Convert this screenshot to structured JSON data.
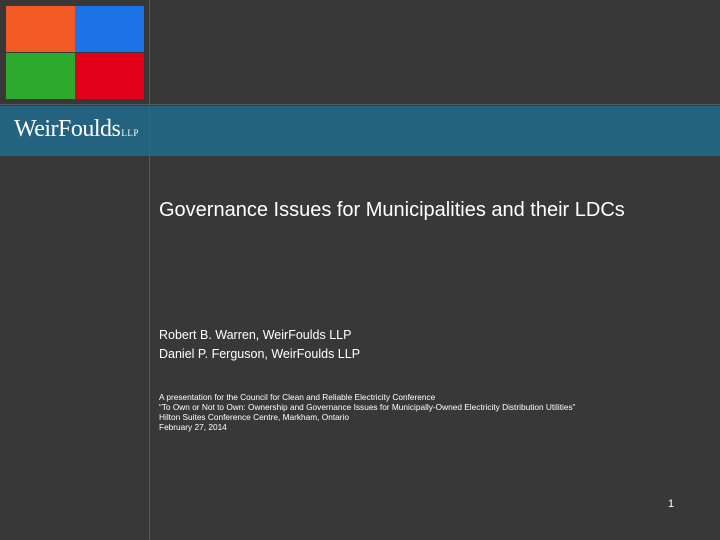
{
  "logo": {
    "name": "WeirFoulds",
    "suffix": "LLP"
  },
  "title": "Governance Issues for Municipalities and their LDCs",
  "authors": [
    "Robert B. Warren, WeirFoulds LLP",
    "Daniel P. Ferguson, WeirFoulds LLP"
  ],
  "conference": [
    "A presentation for the Council for Clean and Reliable Electricity Conference",
    "“To Own or Not to Own: Ownership and Governance Issues for Municipally-Owned Electricity Distribution Utilities”",
    "Hilton Suites Conference Centre, Markham, Ontario",
    "February 27, 2014"
  ],
  "page_number": "1",
  "colors": {
    "background": "#383838",
    "band": "#24637f",
    "square_orange": "#f15a22",
    "square_blue": "#1c73e8",
    "square_green": "#2daa2d",
    "square_red": "#e0001a"
  }
}
